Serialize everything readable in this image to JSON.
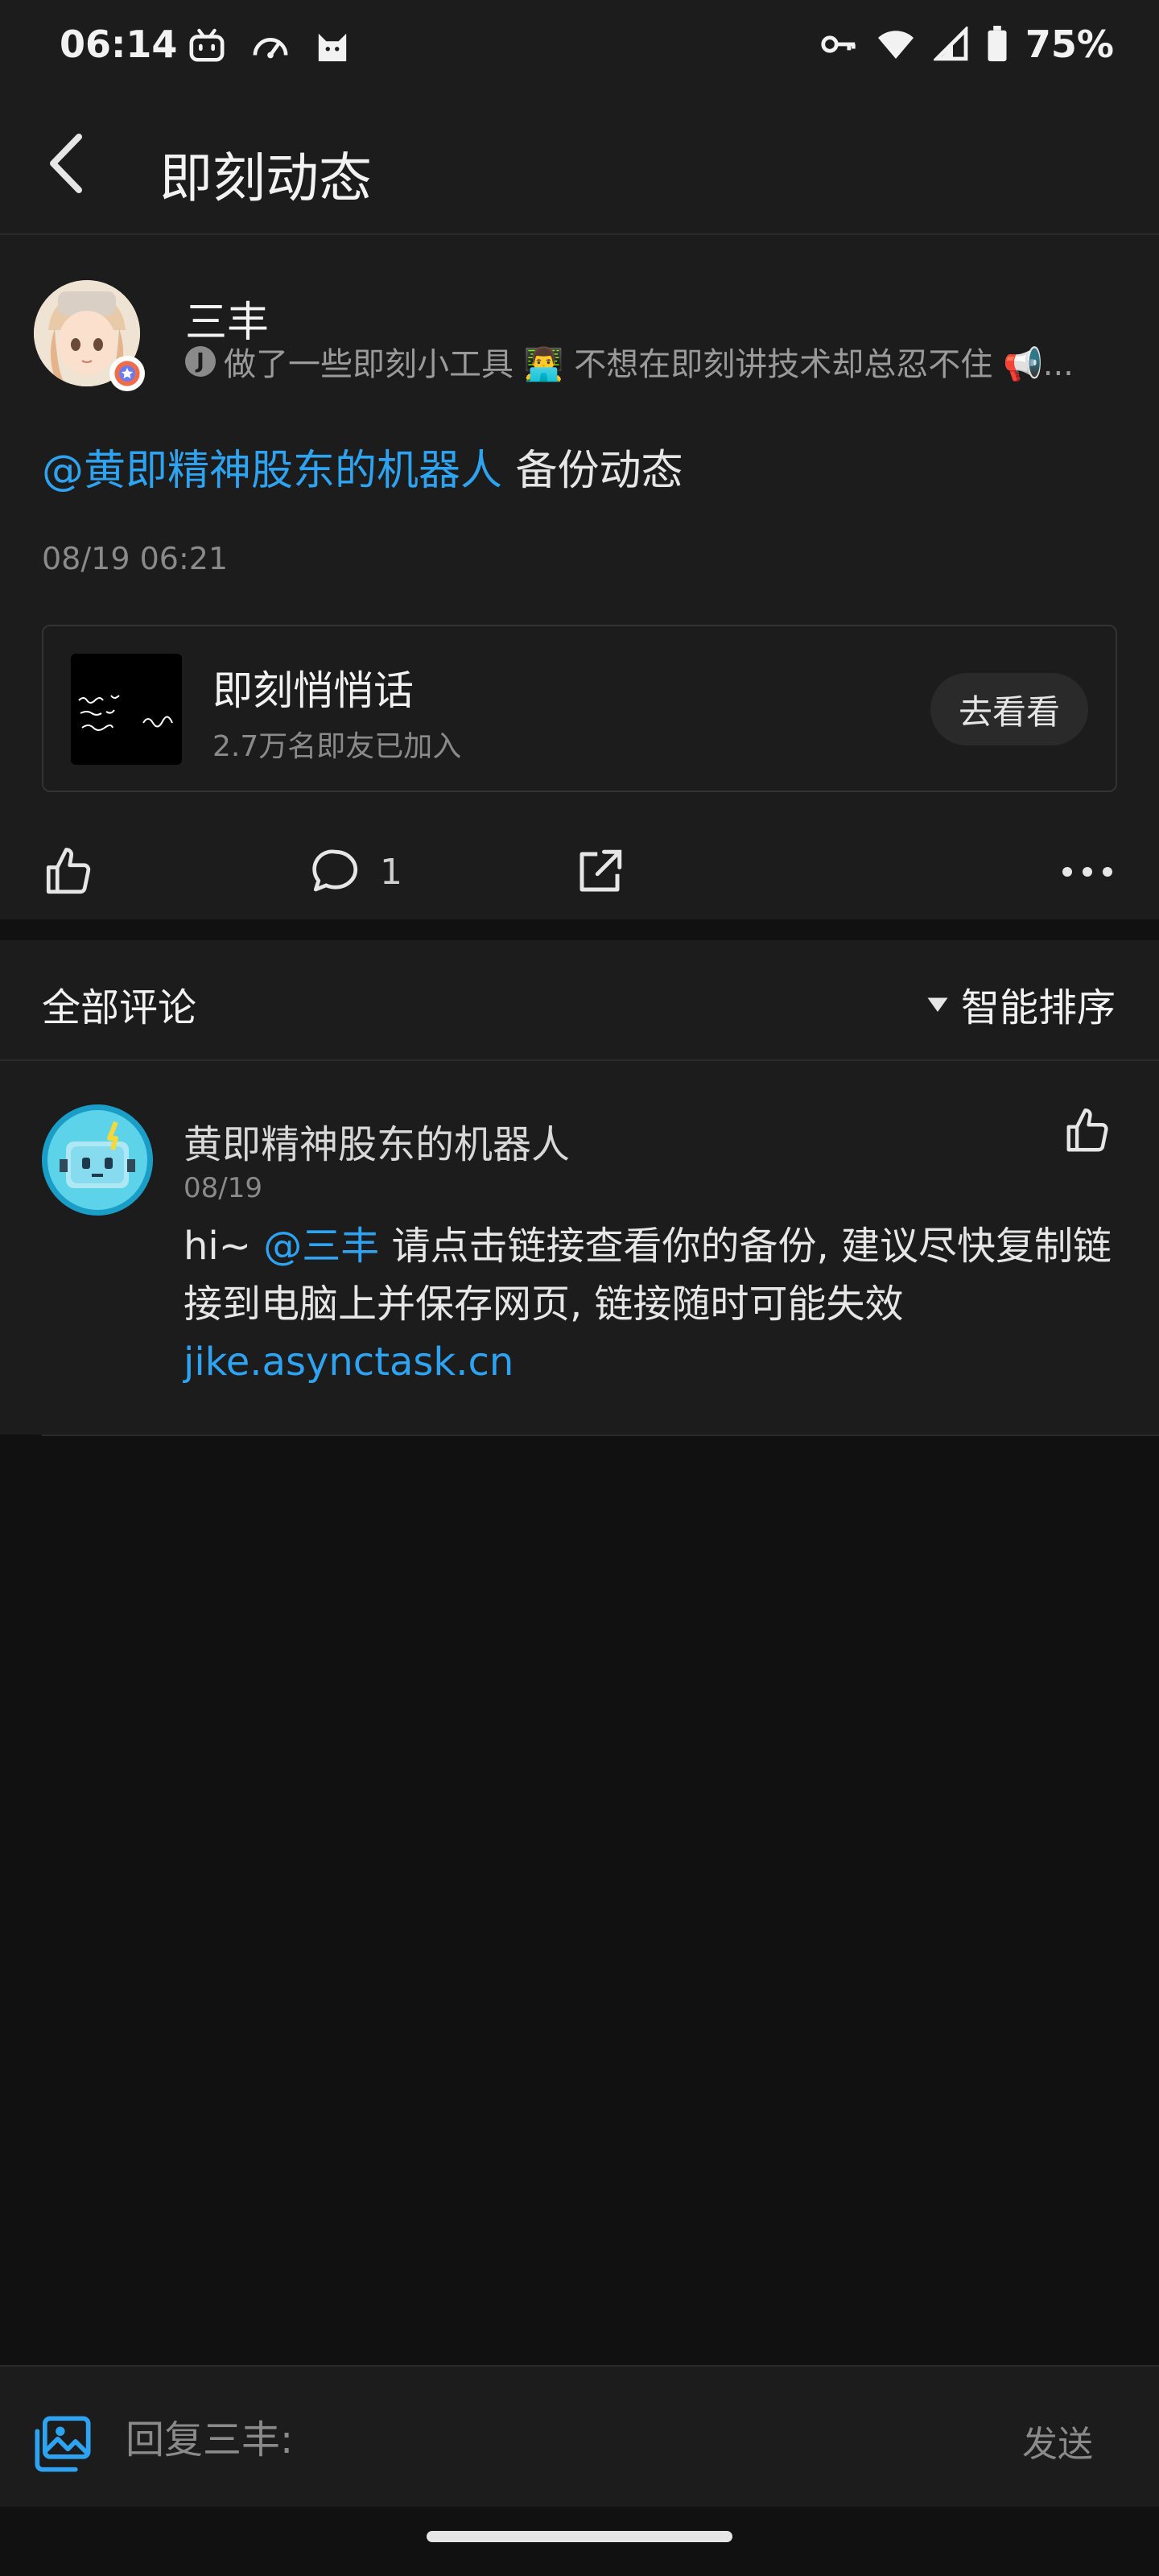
{
  "status_bar": {
    "time": "06:14",
    "battery": "75%",
    "icons_left": [
      "bilibili-icon",
      "speedometer-icon",
      "cat-icon"
    ],
    "icons_right": [
      "vpn-key-icon",
      "wifi-icon",
      "signal-icon",
      "battery-icon"
    ]
  },
  "header": {
    "title": "即刻动态"
  },
  "post": {
    "author": "三丰",
    "bio": "做了一些即刻小工具 👨‍💻 不想在即刻讲技术却总忍不住 📢...",
    "bio_badge": "J",
    "mention": "@黄即精神股东的机器人",
    "text": " 备份动态",
    "time": "08/19 06:21",
    "topic": {
      "title": "即刻悄悄话",
      "subtitle": "2.7万名即友已加入",
      "button": "去看看"
    },
    "comment_count": "1"
  },
  "comments_header": {
    "title": "全部评论",
    "sort": "智能排序"
  },
  "comment": {
    "name": "黄即精神股东的机器人",
    "date": "08/19",
    "prefix": "hi~ ",
    "mention": "@三丰",
    "text": " 请点击链接查看你的备份, 建议尽快复制链接到电脑上并保存网页, 链接随时可能失效",
    "link": "jike.asynctask.cn"
  },
  "reply_bar": {
    "placeholder": "回复三丰:",
    "send": "发送"
  },
  "colors": {
    "accent": "#2ea3f2",
    "background": "#111111",
    "card": "#1c1c1c"
  }
}
